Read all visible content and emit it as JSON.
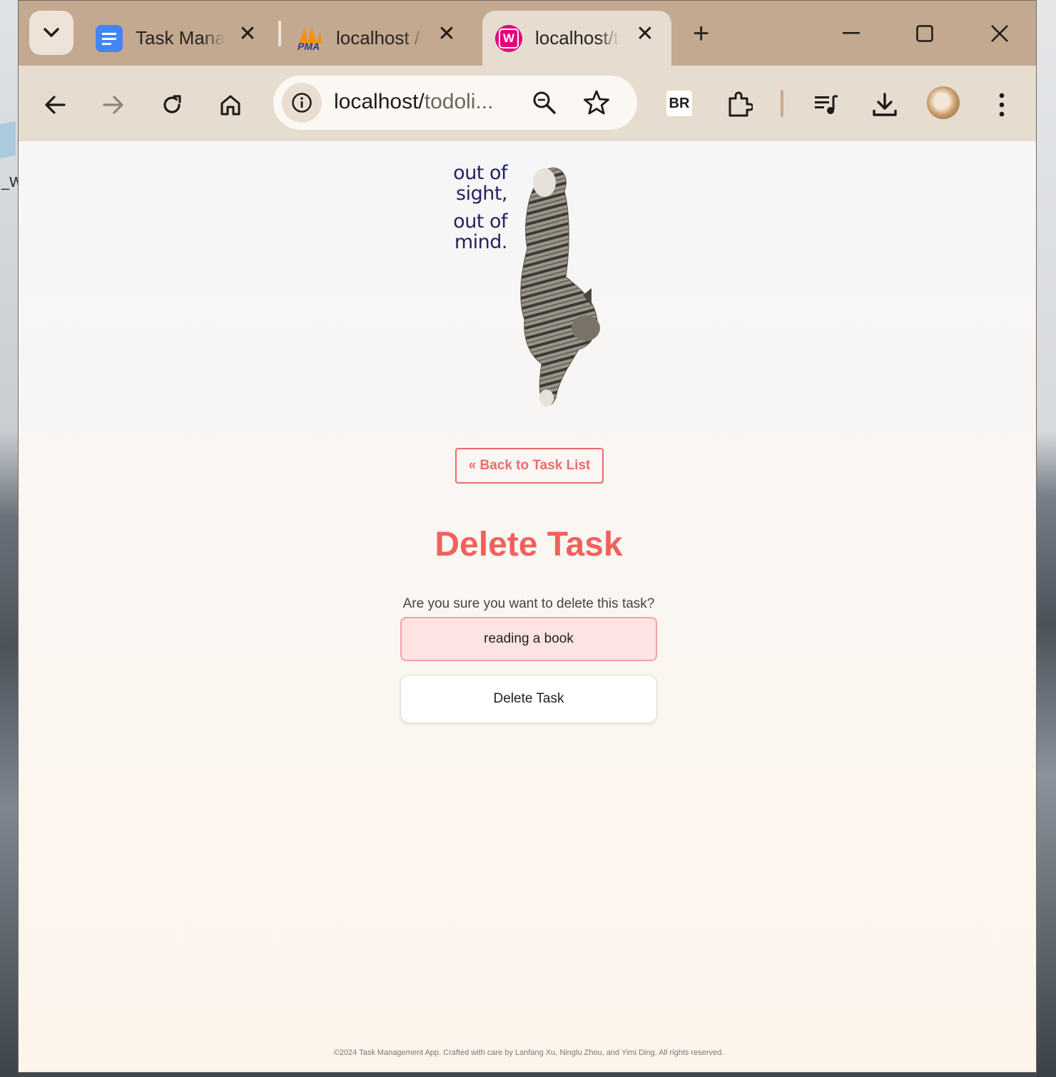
{
  "browser": {
    "tabs": [
      {
        "title": "Task Manag",
        "favicon": "docs-icon",
        "active": false
      },
      {
        "title": "localhost /",
        "favicon": "pma-icon",
        "favicon_text": "PMA",
        "active": false
      },
      {
        "title": "localhost/t",
        "favicon": "wamp-icon",
        "favicon_text": "W",
        "active": true
      }
    ],
    "url_host": "localhost/",
    "url_path": "todoli...",
    "extension_badge": "BR"
  },
  "hero": {
    "line1": "out of",
    "line2": "sight,",
    "line3": "out of",
    "line4": "mind."
  },
  "back_link": "« Back to Task List",
  "heading": "Delete Task",
  "confirm_text": "Are you sure you want to delete this task?",
  "task_name": "reading a book",
  "delete_button": "Delete Task",
  "footer": "©2024 Task Management App. Crafted with care by Lanfang Xu, Ninglu Zhou, and Yimi Ding. All rights reserved.",
  "desktop_label": "_W",
  "colors": {
    "accent": "#f0615e",
    "chrome": "#c2a990",
    "toolbar": "#e6dccf",
    "task_bg": "#fde3e2"
  }
}
